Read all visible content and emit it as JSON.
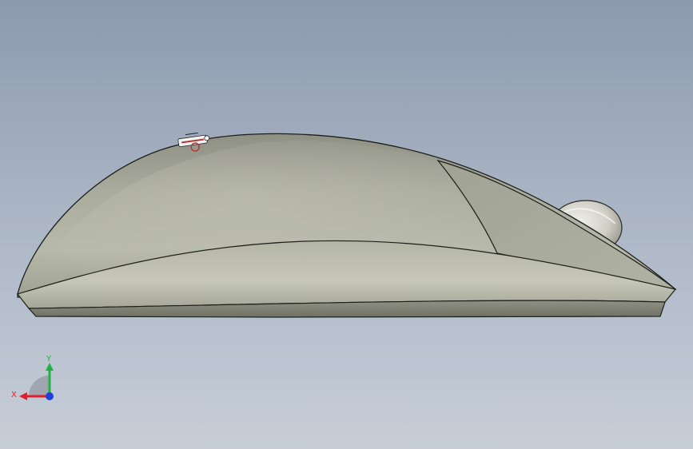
{
  "viewport": {
    "background_top": "#8c9aae",
    "background_bottom": "#c7ced8"
  },
  "model": {
    "body_color": "#a7a99a",
    "edge_color": "#1e1f1a",
    "logo_color": "#b33a3a",
    "wheel_color": "#d8d8d0"
  },
  "triad": {
    "x_label": "X",
    "y_label": "Y",
    "x_color": "#e0202a",
    "y_color": "#22b043",
    "z_color": "#1f3fd8"
  }
}
